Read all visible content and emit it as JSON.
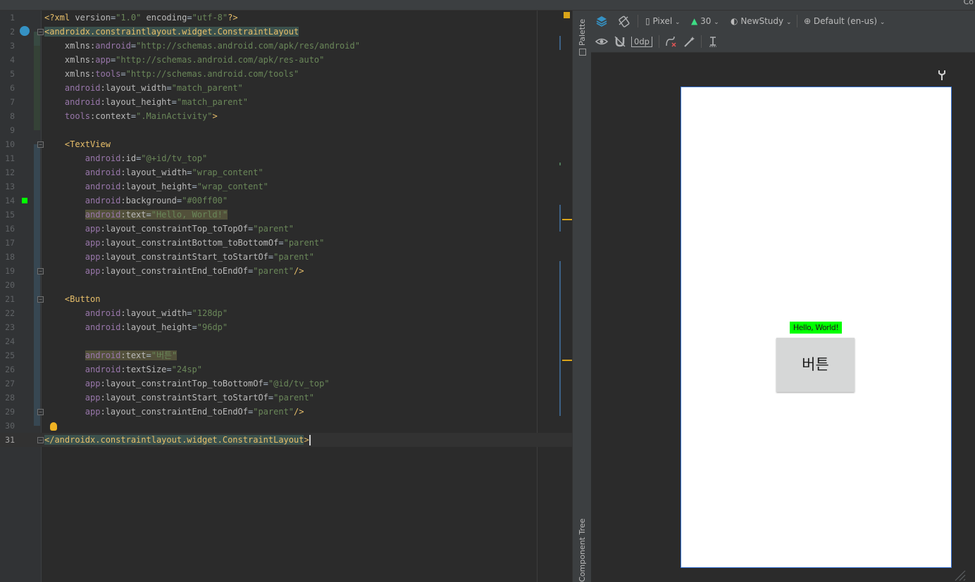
{
  "top_corner_text": "Co",
  "code_lines": [
    {
      "n": "1",
      "parts": [
        {
          "c": "t-xml",
          "t": "<?xml "
        },
        {
          "c": "t-attr",
          "t": "version"
        },
        {
          "c": "",
          "t": "="
        },
        {
          "c": "t-val",
          "t": "\"1.0\""
        },
        {
          "c": "t-attr",
          "t": " encoding"
        },
        {
          "c": "",
          "t": "="
        },
        {
          "c": "t-val",
          "t": "\"utf-8\""
        },
        {
          "c": "t-xml",
          "t": "?>"
        }
      ]
    },
    {
      "n": "2",
      "parts": [
        {
          "c": "t-tag tagbg",
          "t": "<androidx.constraintlayout.widget.ConstraintLayout"
        }
      ]
    },
    {
      "n": "3",
      "parts": [
        {
          "c": "t-attr",
          "t": "    xmlns:"
        },
        {
          "c": "t-ns",
          "t": "android"
        },
        {
          "c": "",
          "t": "="
        },
        {
          "c": "t-val",
          "t": "\"http://schemas.android.com/apk/res/android\""
        }
      ]
    },
    {
      "n": "4",
      "parts": [
        {
          "c": "t-attr",
          "t": "    xmlns:"
        },
        {
          "c": "t-ns",
          "t": "app"
        },
        {
          "c": "",
          "t": "="
        },
        {
          "c": "t-val",
          "t": "\"http://schemas.android.com/apk/res-auto\""
        }
      ]
    },
    {
      "n": "5",
      "parts": [
        {
          "c": "t-attr",
          "t": "    xmlns:"
        },
        {
          "c": "t-ns",
          "t": "tools"
        },
        {
          "c": "",
          "t": "="
        },
        {
          "c": "t-val",
          "t": "\"http://schemas.android.com/tools\""
        }
      ]
    },
    {
      "n": "6",
      "parts": [
        {
          "c": "t-ns",
          "t": "    android"
        },
        {
          "c": "t-attr",
          "t": ":layout_width"
        },
        {
          "c": "",
          "t": "="
        },
        {
          "c": "t-val",
          "t": "\"match_parent\""
        }
      ]
    },
    {
      "n": "7",
      "parts": [
        {
          "c": "t-ns",
          "t": "    android"
        },
        {
          "c": "t-attr",
          "t": ":layout_height"
        },
        {
          "c": "",
          "t": "="
        },
        {
          "c": "t-val",
          "t": "\"match_parent\""
        }
      ]
    },
    {
      "n": "8",
      "parts": [
        {
          "c": "t-ns",
          "t": "    tools"
        },
        {
          "c": "t-attr",
          "t": ":context"
        },
        {
          "c": "",
          "t": "="
        },
        {
          "c": "t-val",
          "t": "\".MainActivity\""
        },
        {
          "c": "t-tag",
          "t": ">"
        }
      ]
    },
    {
      "n": "9",
      "parts": []
    },
    {
      "n": "10",
      "parts": [
        {
          "c": "t-tag",
          "t": "    <TextView"
        }
      ]
    },
    {
      "n": "11",
      "parts": [
        {
          "c": "t-ns",
          "t": "        android"
        },
        {
          "c": "t-attr",
          "t": ":id"
        },
        {
          "c": "",
          "t": "="
        },
        {
          "c": "t-val",
          "t": "\"@+id/tv_top\""
        }
      ]
    },
    {
      "n": "12",
      "parts": [
        {
          "c": "t-ns",
          "t": "        android"
        },
        {
          "c": "t-attr",
          "t": ":layout_width"
        },
        {
          "c": "",
          "t": "="
        },
        {
          "c": "t-val",
          "t": "\"wrap_content\""
        }
      ]
    },
    {
      "n": "13",
      "parts": [
        {
          "c": "t-ns",
          "t": "        android"
        },
        {
          "c": "t-attr",
          "t": ":layout_height"
        },
        {
          "c": "",
          "t": "="
        },
        {
          "c": "t-val",
          "t": "\"wrap_content\""
        }
      ]
    },
    {
      "n": "14",
      "parts": [
        {
          "c": "t-ns",
          "t": "        android"
        },
        {
          "c": "t-attr",
          "t": ":background"
        },
        {
          "c": "",
          "t": "="
        },
        {
          "c": "t-val",
          "t": "\"#00ff00\""
        }
      ]
    },
    {
      "n": "15",
      "parts": [
        {
          "c": "",
          "t": "        "
        },
        {
          "c": "t-ns hl",
          "t": "android"
        },
        {
          "c": "t-attr hl",
          "t": ":text"
        },
        {
          "c": "hl",
          "t": "="
        },
        {
          "c": "t-val hl",
          "t": "\"Hello, World!\""
        }
      ]
    },
    {
      "n": "16",
      "parts": [
        {
          "c": "t-ns",
          "t": "        app"
        },
        {
          "c": "t-attr",
          "t": ":layout_constraintTop_toTopOf"
        },
        {
          "c": "",
          "t": "="
        },
        {
          "c": "t-val",
          "t": "\"parent\""
        }
      ]
    },
    {
      "n": "17",
      "parts": [
        {
          "c": "t-ns",
          "t": "        app"
        },
        {
          "c": "t-attr",
          "t": ":layout_constraintBottom_toBottomOf"
        },
        {
          "c": "",
          "t": "="
        },
        {
          "c": "t-val",
          "t": "\"parent\""
        }
      ]
    },
    {
      "n": "18",
      "parts": [
        {
          "c": "t-ns",
          "t": "        app"
        },
        {
          "c": "t-attr",
          "t": ":layout_constraintStart_toStartOf"
        },
        {
          "c": "",
          "t": "="
        },
        {
          "c": "t-val",
          "t": "\"parent\""
        }
      ]
    },
    {
      "n": "19",
      "parts": [
        {
          "c": "t-ns",
          "t": "        app"
        },
        {
          "c": "t-attr",
          "t": ":layout_constraintEnd_toEndOf"
        },
        {
          "c": "",
          "t": "="
        },
        {
          "c": "t-val",
          "t": "\"parent\""
        },
        {
          "c": "t-tag",
          "t": "/>"
        }
      ]
    },
    {
      "n": "20",
      "parts": []
    },
    {
      "n": "21",
      "parts": [
        {
          "c": "t-tag",
          "t": "    <Button"
        }
      ]
    },
    {
      "n": "22",
      "parts": [
        {
          "c": "t-ns",
          "t": "        android"
        },
        {
          "c": "t-attr",
          "t": ":layout_width"
        },
        {
          "c": "",
          "t": "="
        },
        {
          "c": "t-val",
          "t": "\"128dp\""
        }
      ]
    },
    {
      "n": "23",
      "parts": [
        {
          "c": "t-ns",
          "t": "        android"
        },
        {
          "c": "t-attr",
          "t": ":layout_height"
        },
        {
          "c": "",
          "t": "="
        },
        {
          "c": "t-val",
          "t": "\"96dp\""
        }
      ]
    },
    {
      "n": "24",
      "parts": []
    },
    {
      "n": "25",
      "parts": [
        {
          "c": "",
          "t": "        "
        },
        {
          "c": "t-ns hl",
          "t": "android"
        },
        {
          "c": "t-attr hl",
          "t": ":text"
        },
        {
          "c": "hl",
          "t": "="
        },
        {
          "c": "t-val hl",
          "t": "\"버튼\""
        }
      ]
    },
    {
      "n": "26",
      "parts": [
        {
          "c": "t-ns",
          "t": "        android"
        },
        {
          "c": "t-attr",
          "t": ":textSize"
        },
        {
          "c": "",
          "t": "="
        },
        {
          "c": "t-val",
          "t": "\"24sp\""
        }
      ]
    },
    {
      "n": "27",
      "parts": [
        {
          "c": "t-ns",
          "t": "        app"
        },
        {
          "c": "t-attr",
          "t": ":layout_constraintTop_toBottomOf"
        },
        {
          "c": "",
          "t": "="
        },
        {
          "c": "t-val",
          "t": "\"@id/tv_top\""
        }
      ]
    },
    {
      "n": "28",
      "parts": [
        {
          "c": "t-ns",
          "t": "        app"
        },
        {
          "c": "t-attr",
          "t": ":layout_constraintStart_toStartOf"
        },
        {
          "c": "",
          "t": "="
        },
        {
          "c": "t-val",
          "t": "\"parent\""
        }
      ]
    },
    {
      "n": "29",
      "parts": [
        {
          "c": "t-ns",
          "t": "        app"
        },
        {
          "c": "t-attr",
          "t": ":layout_constraintEnd_toEndOf"
        },
        {
          "c": "",
          "t": "="
        },
        {
          "c": "t-val",
          "t": "\"parent\""
        },
        {
          "c": "t-tag",
          "t": "/>"
        }
      ]
    },
    {
      "n": "30",
      "parts": []
    },
    {
      "n": "31",
      "parts": [
        {
          "c": "t-tag tagbg",
          "t": "</androidx.constraintlayout.widget.ConstraintLayout"
        },
        {
          "c": "t-tag",
          "t": ">"
        }
      ],
      "active": true
    }
  ],
  "side_panel": {
    "palette_label": "Palette",
    "component_tree_label": "Component Tree"
  },
  "toolbar": {
    "device_label": "Pixel",
    "api_label": "30",
    "theme_label": "NewStudy",
    "locale_label": "Default (en-us)",
    "margin_value": "0dp"
  },
  "preview": {
    "textview_text": "Hello, World!",
    "button_text": "버튼",
    "textview_bg_color": "#00ff00"
  }
}
